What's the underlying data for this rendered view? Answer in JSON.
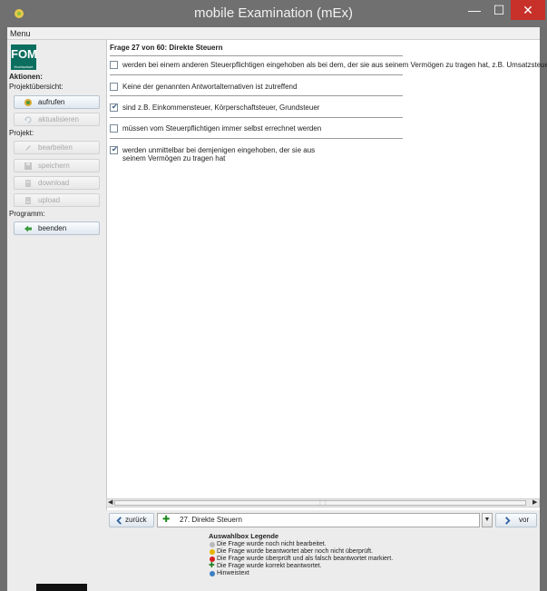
{
  "window": {
    "title": "mobile Examination (mEx)",
    "minimize_glyph": "—",
    "maximize_glyph": "☐",
    "close_glyph": "✕"
  },
  "menubar": {
    "menu_label": "Menu"
  },
  "sidebar": {
    "logo_text": "FOM",
    "logo_subtext": "Hochschule",
    "aktionen_label": "Aktionen:",
    "projektuebersicht_label": "Projektübersicht:",
    "aufrufen_button": "aufrufen",
    "aktualisieren_button": "aktualisieren",
    "projekt_label": "Projekt:",
    "bearbeiten_button": "bearbeiten",
    "speichern_button": "speichern",
    "download_button": "download",
    "upload_button": "upload",
    "programm_label": "Programm:",
    "beenden_button": "beenden"
  },
  "question": {
    "title": "Frage 27 von 60: Direkte Steuern",
    "answers": [
      {
        "text": "werden bei einem anderen Steuerpflichtigen eingehoben als bei dem, der sie aus seinem Vermögen zu tragen hat, z.B. Umsatzsteuer",
        "checked": false
      },
      {
        "text": "Keine der genannten Antwortalternativen ist zutreffend",
        "checked": false
      },
      {
        "text": "sind z.B. Einkommensteuer, Körperschaftsteuer, Grundsteuer",
        "checked": true
      },
      {
        "text": "müssen vom Steuerpflichtigen immer selbst errechnet werden",
        "checked": false
      },
      {
        "text_line1": "werden unmittelbar bei demjenigen eingehoben, der sie aus",
        "text_line2": "seinem Vermögen zu tragen hat",
        "checked": true
      }
    ]
  },
  "navigation": {
    "back_label": "zurück",
    "next_label": "vor",
    "selected_question": "27. Direkte Steuern"
  },
  "legend": {
    "title": "Auswahlbox Legende",
    "items": [
      {
        "text": "Die Frage wurde noch nicht bearbeitet.",
        "color": "#b9b9b9",
        "icon": "grey-dot-icon"
      },
      {
        "text": "Die Frage wurde beantwortet aber noch nicht überprüft.",
        "color": "#e8b400",
        "icon": "yellow-dot-icon"
      },
      {
        "text": "Die Frage wurde überprüft und als falsch beantwortet markiert.",
        "color": "#d81f1f",
        "icon": "red-dot-icon"
      },
      {
        "text": "Die Frage wurde korrekt beantwortet.",
        "color": "#1a7a1a",
        "icon": "green-plus-icon"
      },
      {
        "text": "Hinweistext",
        "color": "#3b7fc4",
        "icon": "blue-dot-icon"
      }
    ]
  },
  "colors": {
    "logo_green": "#0b6e5e",
    "close_red": "#c7312a",
    "title_grey": "#707070"
  }
}
